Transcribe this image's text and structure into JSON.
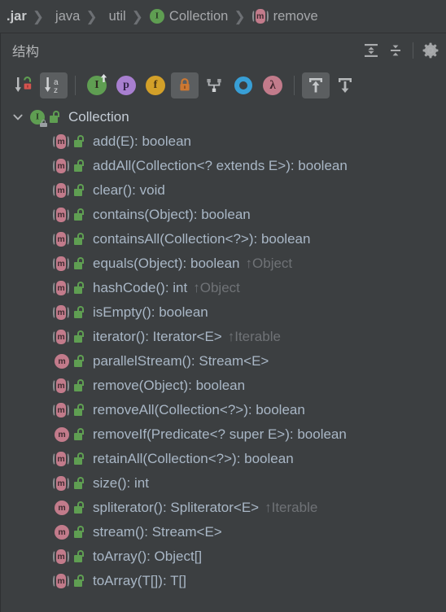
{
  "breadcrumb": {
    "items": [
      {
        "label": ".jar",
        "icon": "none",
        "bold": true
      },
      {
        "label": "java",
        "icon": "none",
        "bold": false
      },
      {
        "label": "util",
        "icon": "none",
        "bold": false
      },
      {
        "label": "Collection",
        "icon": "interface-icon",
        "bold": false
      },
      {
        "label": "remove",
        "icon": "method-abstract-icon",
        "bold": false
      }
    ],
    "separator": "❯"
  },
  "panel": {
    "title": "结构",
    "header_buttons": [
      {
        "name": "expand-all-button",
        "tooltip": "Expand All"
      },
      {
        "name": "collapse-all-button",
        "tooltip": "Collapse All"
      },
      {
        "name": "settings-gear-button",
        "tooltip": "Settings"
      }
    ],
    "toolbar": [
      {
        "name": "sort-by-visibility-button",
        "icon": "sort-visibility-icon",
        "active": false
      },
      {
        "name": "sort-alphabetically-button",
        "icon": "sort-alpha-icon",
        "active": true
      },
      {
        "name": "show-inherited-button",
        "icon": "inherited-members-icon",
        "glyph": "I",
        "color": "#5f9e52",
        "active": false
      },
      {
        "name": "show-properties-button",
        "icon": "properties-icon",
        "glyph": "p",
        "color": "#a87fd0",
        "active": false
      },
      {
        "name": "show-fields-button",
        "icon": "fields-icon",
        "glyph": "f",
        "color": "#d3a029",
        "active": false
      },
      {
        "name": "show-non-public-button",
        "icon": "lock-icon",
        "color": "#cc7832",
        "active": true
      },
      {
        "name": "group-by-implementation-button",
        "icon": "hierarchy-icon",
        "color": "#9b9ea1",
        "active": false
      },
      {
        "name": "show-anonymous-classes-button",
        "icon": "anonymous-class-icon",
        "color": "#389fd6",
        "active": false
      },
      {
        "name": "show-lambdas-button",
        "icon": "lambda-icon",
        "glyph": "λ",
        "color": "#c27b8b",
        "active": false
      },
      {
        "name": "autoscroll-to-source-button",
        "icon": "scroll-from-source-icon",
        "active": true
      },
      {
        "name": "autoscroll-from-source-button",
        "icon": "scroll-to-source-icon",
        "active": false
      }
    ]
  },
  "tree": {
    "root": {
      "label": "Collection",
      "icon": "interface-icon",
      "access_icon": "public-lock-icon",
      "locked": true,
      "expanded": true,
      "twisty": "⌄"
    },
    "members": [
      {
        "label": "add(E): boolean",
        "icon": "method-abstract-icon",
        "access_icon": "public-lock-icon",
        "override": ""
      },
      {
        "label": "addAll(Collection<? extends E>): boolean",
        "icon": "method-abstract-icon",
        "access_icon": "public-lock-icon",
        "override": ""
      },
      {
        "label": "clear(): void",
        "icon": "method-abstract-icon",
        "access_icon": "public-lock-icon",
        "override": ""
      },
      {
        "label": "contains(Object): boolean",
        "icon": "method-abstract-icon",
        "access_icon": "public-lock-icon",
        "override": ""
      },
      {
        "label": "containsAll(Collection<?>): boolean",
        "icon": "method-abstract-icon",
        "access_icon": "public-lock-icon",
        "override": ""
      },
      {
        "label": "equals(Object): boolean",
        "icon": "method-abstract-icon",
        "access_icon": "public-lock-icon",
        "override": "↑Object"
      },
      {
        "label": "hashCode(): int",
        "icon": "method-abstract-icon",
        "access_icon": "public-lock-icon",
        "override": "↑Object"
      },
      {
        "label": "isEmpty(): boolean",
        "icon": "method-abstract-icon",
        "access_icon": "public-lock-icon",
        "override": ""
      },
      {
        "label": "iterator(): Iterator<E>",
        "icon": "method-abstract-icon",
        "access_icon": "public-lock-icon",
        "override": "↑Iterable"
      },
      {
        "label": "parallelStream(): Stream<E>",
        "icon": "method-default-icon",
        "access_icon": "public-lock-icon",
        "override": ""
      },
      {
        "label": "remove(Object): boolean",
        "icon": "method-abstract-icon",
        "access_icon": "public-lock-icon",
        "override": ""
      },
      {
        "label": "removeAll(Collection<?>): boolean",
        "icon": "method-abstract-icon",
        "access_icon": "public-lock-icon",
        "override": ""
      },
      {
        "label": "removeIf(Predicate<? super E>): boolean",
        "icon": "method-default-icon",
        "access_icon": "public-lock-icon",
        "override": ""
      },
      {
        "label": "retainAll(Collection<?>): boolean",
        "icon": "method-abstract-icon",
        "access_icon": "public-lock-icon",
        "override": ""
      },
      {
        "label": "size(): int",
        "icon": "method-abstract-icon",
        "access_icon": "public-lock-icon",
        "override": ""
      },
      {
        "label": "spliterator(): Spliterator<E>",
        "icon": "method-default-icon",
        "access_icon": "public-lock-icon",
        "override": "↑Iterable"
      },
      {
        "label": "stream(): Stream<E>",
        "icon": "method-default-icon",
        "access_icon": "public-lock-icon",
        "override": ""
      },
      {
        "label": "toArray(): Object[]",
        "icon": "method-abstract-icon",
        "access_icon": "public-lock-icon",
        "override": ""
      },
      {
        "label": "toArray(T[]): T[]",
        "icon": "method-abstract-icon",
        "access_icon": "public-lock-icon",
        "override": ""
      }
    ]
  },
  "colors": {
    "background": "#3c3f41",
    "text": "#a9b7c6",
    "muted_text": "#6f7276",
    "interface_green": "#5f9e52",
    "method_rose": "#c27b8b",
    "public_green": "#5f9e52",
    "selected_button": "#5b5e60"
  }
}
